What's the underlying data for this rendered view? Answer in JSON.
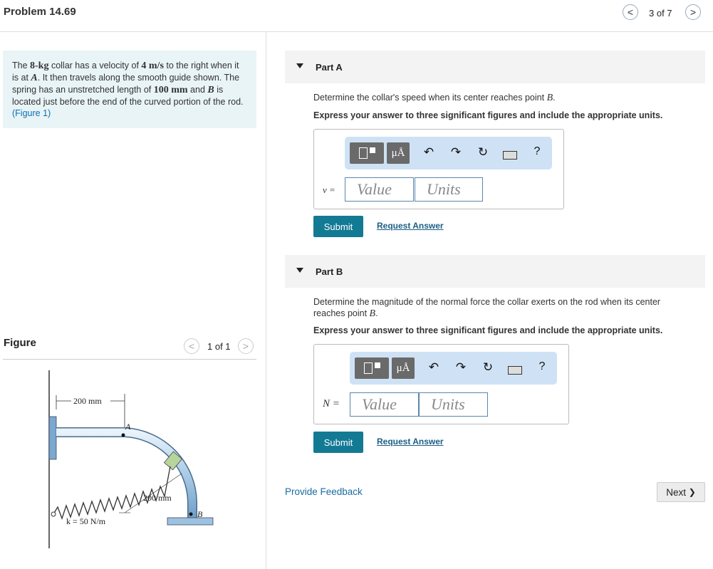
{
  "header": {
    "problem_title": "Problem 14.69",
    "page_indicator": "3 of 7",
    "prev_glyph": "<",
    "next_glyph": ">"
  },
  "problem": {
    "t1": "The ",
    "mass": "8-kg",
    "t2": " collar has a velocity of ",
    "velocity": "4  m/s",
    "t3": " to the right when it is at ",
    "pointA": "A",
    "t4": ". It then travels along the smooth guide shown. The spring has an unstretched length of ",
    "length": "100 mm",
    "t5": " and ",
    "pointB": "B",
    "t6": " is located just before the end of the curved portion of the rod. ",
    "figure_link": "(Figure 1)"
  },
  "figure": {
    "label": "Figure",
    "pager": "1 of 1",
    "dim_top": "200 mm",
    "dim_radius": "200 mm",
    "label_A": "A",
    "label_B": "B",
    "spring_k": "k = 50 N/m"
  },
  "partA": {
    "label": "Part A",
    "question_pre": "Determine the collar's speed when its center reaches point ",
    "question_var": "B",
    "question_post": ".",
    "instruction": "Express your answer to three significant figures and include the appropriate units.",
    "var_label": "v =",
    "value_placeholder": "Value",
    "units_placeholder": "Units",
    "submit": "Submit",
    "request": "Request Answer"
  },
  "partB": {
    "label": "Part B",
    "question_pre": "Determine the magnitude of the normal force the collar exerts on the rod when its center reaches point ",
    "question_var": "B",
    "question_post": ".",
    "instruction": "Express your answer to three significant figures and include the appropriate units.",
    "var_label": "N =",
    "value_placeholder": "Value",
    "units_placeholder": "Units",
    "submit": "Submit",
    "request": "Request Answer"
  },
  "toolbar": {
    "mu_label": "μÅ",
    "undo": "↶",
    "redo": "↷",
    "reset": "↻",
    "help": "?"
  },
  "footer": {
    "provide_feedback": "Provide Feedback",
    "next_label": "Next",
    "next_chevron": "❯"
  }
}
